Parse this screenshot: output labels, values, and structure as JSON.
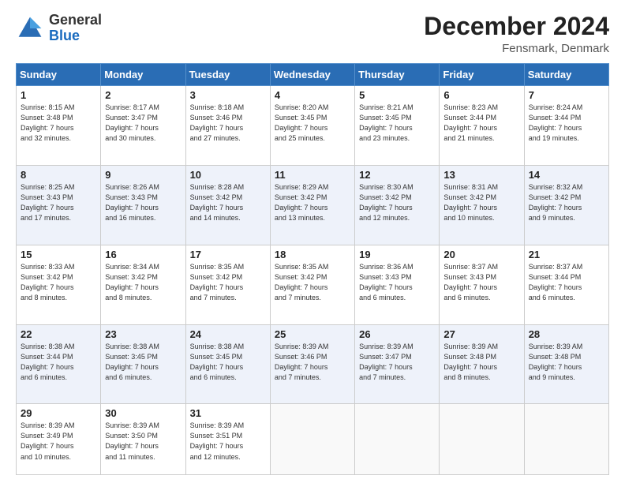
{
  "header": {
    "logo_line1": "General",
    "logo_line2": "Blue",
    "month": "December 2024",
    "location": "Fensmark, Denmark"
  },
  "days_of_week": [
    "Sunday",
    "Monday",
    "Tuesday",
    "Wednesday",
    "Thursday",
    "Friday",
    "Saturday"
  ],
  "weeks": [
    [
      {
        "day": "1",
        "info": "Sunrise: 8:15 AM\nSunset: 3:48 PM\nDaylight: 7 hours\nand 32 minutes."
      },
      {
        "day": "2",
        "info": "Sunrise: 8:17 AM\nSunset: 3:47 PM\nDaylight: 7 hours\nand 30 minutes."
      },
      {
        "day": "3",
        "info": "Sunrise: 8:18 AM\nSunset: 3:46 PM\nDaylight: 7 hours\nand 27 minutes."
      },
      {
        "day": "4",
        "info": "Sunrise: 8:20 AM\nSunset: 3:45 PM\nDaylight: 7 hours\nand 25 minutes."
      },
      {
        "day": "5",
        "info": "Sunrise: 8:21 AM\nSunset: 3:45 PM\nDaylight: 7 hours\nand 23 minutes."
      },
      {
        "day": "6",
        "info": "Sunrise: 8:23 AM\nSunset: 3:44 PM\nDaylight: 7 hours\nand 21 minutes."
      },
      {
        "day": "7",
        "info": "Sunrise: 8:24 AM\nSunset: 3:44 PM\nDaylight: 7 hours\nand 19 minutes."
      }
    ],
    [
      {
        "day": "8",
        "info": "Sunrise: 8:25 AM\nSunset: 3:43 PM\nDaylight: 7 hours\nand 17 minutes."
      },
      {
        "day": "9",
        "info": "Sunrise: 8:26 AM\nSunset: 3:43 PM\nDaylight: 7 hours\nand 16 minutes."
      },
      {
        "day": "10",
        "info": "Sunrise: 8:28 AM\nSunset: 3:42 PM\nDaylight: 7 hours\nand 14 minutes."
      },
      {
        "day": "11",
        "info": "Sunrise: 8:29 AM\nSunset: 3:42 PM\nDaylight: 7 hours\nand 13 minutes."
      },
      {
        "day": "12",
        "info": "Sunrise: 8:30 AM\nSunset: 3:42 PM\nDaylight: 7 hours\nand 12 minutes."
      },
      {
        "day": "13",
        "info": "Sunrise: 8:31 AM\nSunset: 3:42 PM\nDaylight: 7 hours\nand 10 minutes."
      },
      {
        "day": "14",
        "info": "Sunrise: 8:32 AM\nSunset: 3:42 PM\nDaylight: 7 hours\nand 9 minutes."
      }
    ],
    [
      {
        "day": "15",
        "info": "Sunrise: 8:33 AM\nSunset: 3:42 PM\nDaylight: 7 hours\nand 8 minutes."
      },
      {
        "day": "16",
        "info": "Sunrise: 8:34 AM\nSunset: 3:42 PM\nDaylight: 7 hours\nand 8 minutes."
      },
      {
        "day": "17",
        "info": "Sunrise: 8:35 AM\nSunset: 3:42 PM\nDaylight: 7 hours\nand 7 minutes."
      },
      {
        "day": "18",
        "info": "Sunrise: 8:35 AM\nSunset: 3:42 PM\nDaylight: 7 hours\nand 7 minutes."
      },
      {
        "day": "19",
        "info": "Sunrise: 8:36 AM\nSunset: 3:43 PM\nDaylight: 7 hours\nand 6 minutes."
      },
      {
        "day": "20",
        "info": "Sunrise: 8:37 AM\nSunset: 3:43 PM\nDaylight: 7 hours\nand 6 minutes."
      },
      {
        "day": "21",
        "info": "Sunrise: 8:37 AM\nSunset: 3:44 PM\nDaylight: 7 hours\nand 6 minutes."
      }
    ],
    [
      {
        "day": "22",
        "info": "Sunrise: 8:38 AM\nSunset: 3:44 PM\nDaylight: 7 hours\nand 6 minutes."
      },
      {
        "day": "23",
        "info": "Sunrise: 8:38 AM\nSunset: 3:45 PM\nDaylight: 7 hours\nand 6 minutes."
      },
      {
        "day": "24",
        "info": "Sunrise: 8:38 AM\nSunset: 3:45 PM\nDaylight: 7 hours\nand 6 minutes."
      },
      {
        "day": "25",
        "info": "Sunrise: 8:39 AM\nSunset: 3:46 PM\nDaylight: 7 hours\nand 7 minutes."
      },
      {
        "day": "26",
        "info": "Sunrise: 8:39 AM\nSunset: 3:47 PM\nDaylight: 7 hours\nand 7 minutes."
      },
      {
        "day": "27",
        "info": "Sunrise: 8:39 AM\nSunset: 3:48 PM\nDaylight: 7 hours\nand 8 minutes."
      },
      {
        "day": "28",
        "info": "Sunrise: 8:39 AM\nSunset: 3:48 PM\nDaylight: 7 hours\nand 9 minutes."
      }
    ],
    [
      {
        "day": "29",
        "info": "Sunrise: 8:39 AM\nSunset: 3:49 PM\nDaylight: 7 hours\nand 10 minutes."
      },
      {
        "day": "30",
        "info": "Sunrise: 8:39 AM\nSunset: 3:50 PM\nDaylight: 7 hours\nand 11 minutes."
      },
      {
        "day": "31",
        "info": "Sunrise: 8:39 AM\nSunset: 3:51 PM\nDaylight: 7 hours\nand 12 minutes."
      },
      {
        "day": "",
        "info": ""
      },
      {
        "day": "",
        "info": ""
      },
      {
        "day": "",
        "info": ""
      },
      {
        "day": "",
        "info": ""
      }
    ]
  ]
}
